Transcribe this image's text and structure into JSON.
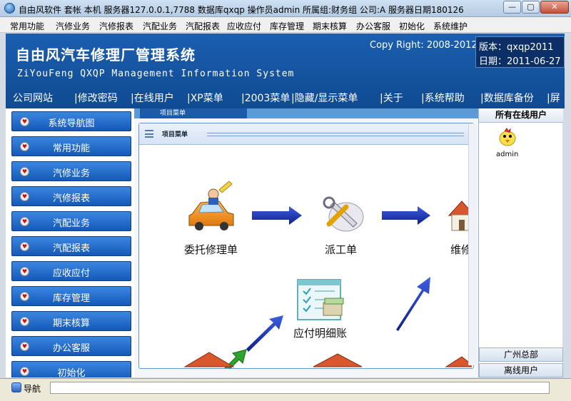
{
  "window": {
    "title": "自由风软件  套帐 本机  服务器127.0.0.1,7788  数据库qxqp  操作员admin  所属组:财务组  公司:A  服务器日期180126",
    "min_label": "—",
    "max_label": "▢",
    "close_label": "✕"
  },
  "menu": {
    "items": [
      "常用功能",
      "汽修业务",
      "汽修报表",
      "汽配业务",
      "汽配报表",
      "应收应付",
      "库存管理",
      "期末核算",
      "办公客服",
      "初始化",
      "系统维护"
    ]
  },
  "banner": {
    "title": "自由风汽车修理厂管理系统",
    "subtitle": "ZiYouFeng QXQP Management Information System",
    "copyright": "Copy Right: 2008-2012",
    "version": "版本：qxqp2011",
    "date": "日期：2011-06-27"
  },
  "quickbar": {
    "items": [
      "公司网站",
      "|修改密码",
      "|在线用户",
      "|XP菜单",
      "|2003菜单",
      "|隐藏/显示菜单",
      "|关于",
      "|系统帮助",
      "|数据库备份",
      "|屏"
    ]
  },
  "sidebar": {
    "items": [
      "系统导航图",
      "常用功能",
      "汽修业务",
      "汽修报表",
      "汽配业务",
      "汽配报表",
      "应收应付",
      "库存管理",
      "期末核算",
      "办公客服",
      "初始化"
    ]
  },
  "content": {
    "tab_label": "项目菜单",
    "panel_title": "项目菜单",
    "flow": {
      "step1": "委托修理单",
      "step2": "派工单",
      "step3": "维修",
      "step4": "应付明细账"
    }
  },
  "online": {
    "header": "所有在线用户",
    "user": "admin",
    "group": "广州总部",
    "offline": "离线用户"
  },
  "status": {
    "label": "导航"
  },
  "colors": {
    "banner": "#14539f",
    "nav_button": "#1559b8",
    "arrow": "#1e2fa8"
  }
}
